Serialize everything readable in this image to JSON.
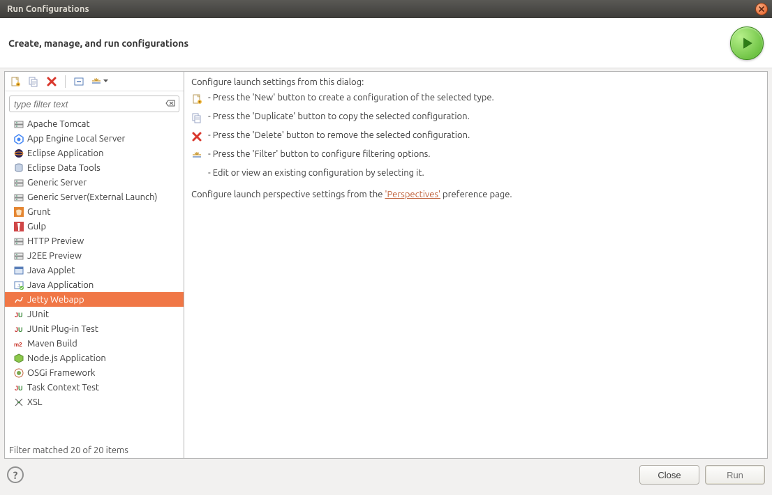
{
  "window": {
    "title": "Run Configurations"
  },
  "header": {
    "title": "Create, manage, and run configurations"
  },
  "filter": {
    "placeholder": "type filter text"
  },
  "tree": {
    "items": [
      {
        "label": "Apache Tomcat",
        "icon": "server"
      },
      {
        "label": "App Engine Local Server",
        "icon": "appengine"
      },
      {
        "label": "Eclipse Application",
        "icon": "eclipse"
      },
      {
        "label": "Eclipse Data Tools",
        "icon": "db"
      },
      {
        "label": "Generic Server",
        "icon": "server"
      },
      {
        "label": "Generic Server(External Launch)",
        "icon": "server"
      },
      {
        "label": "Grunt",
        "icon": "grunt"
      },
      {
        "label": "Gulp",
        "icon": "gulp"
      },
      {
        "label": "HTTP Preview",
        "icon": "server"
      },
      {
        "label": "J2EE Preview",
        "icon": "server"
      },
      {
        "label": "Java Applet",
        "icon": "applet"
      },
      {
        "label": "Java Application",
        "icon": "javaapp"
      },
      {
        "label": "Jetty Webapp",
        "icon": "jetty",
        "selected": true
      },
      {
        "label": "JUnit",
        "icon": "junit"
      },
      {
        "label": "JUnit Plug-in Test",
        "icon": "junit"
      },
      {
        "label": "Maven Build",
        "icon": "maven"
      },
      {
        "label": "Node.js Application",
        "icon": "node"
      },
      {
        "label": "OSGi Framework",
        "icon": "osgi"
      },
      {
        "label": "Task Context Test",
        "icon": "junit"
      },
      {
        "label": "XSL",
        "icon": "xsl"
      }
    ]
  },
  "status": {
    "filter_matched": "Filter matched 20 of 20 items"
  },
  "instructions": {
    "title": "Configure launch settings from this dialog:",
    "new": "- Press the 'New' button to create a configuration of the selected type.",
    "dup": "- Press the 'Duplicate' button to copy the selected configuration.",
    "del": "- Press the 'Delete' button to remove the selected configuration.",
    "filt": "- Press the 'Filter' button to configure filtering options.",
    "edit": "- Edit or view an existing configuration by selecting it.",
    "persp_pre": "Configure launch perspective settings from the ",
    "persp_link": "'Perspectives'",
    "persp_post": " preference page."
  },
  "buttons": {
    "close": "Close",
    "run": "Run"
  }
}
